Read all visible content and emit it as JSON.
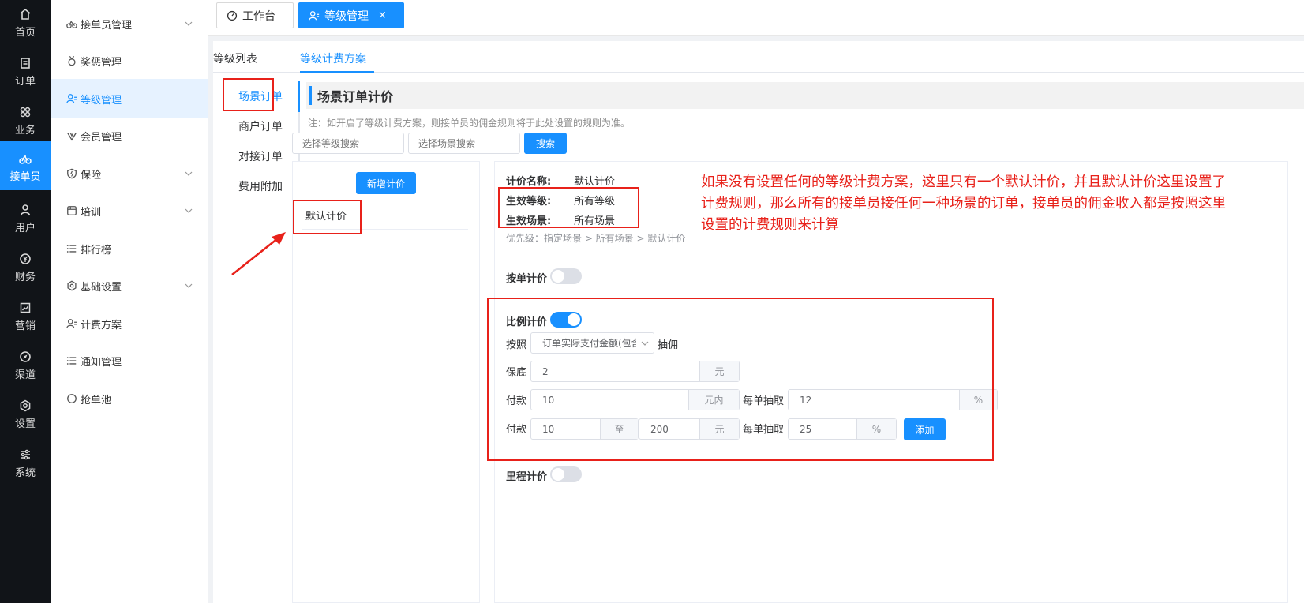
{
  "nav_rail": [
    {
      "icon": "home-icon",
      "label": "首页"
    },
    {
      "icon": "order-icon",
      "label": "订单"
    },
    {
      "icon": "grid-icon",
      "label": "业务"
    },
    {
      "icon": "bike-icon",
      "label": "接单员"
    },
    {
      "icon": "user-icon",
      "label": "用户"
    },
    {
      "icon": "yen-icon",
      "label": "财务"
    },
    {
      "icon": "chart-icon",
      "label": "营销"
    },
    {
      "icon": "compass-icon",
      "label": "渠道"
    },
    {
      "icon": "settings-icon",
      "label": "设置"
    },
    {
      "icon": "sliders-icon",
      "label": "系统"
    }
  ],
  "submenu": [
    {
      "icon": "bike-icon",
      "label": "接单员管理",
      "expandable": true
    },
    {
      "icon": "medal-icon",
      "label": "奖惩管理",
      "expandable": false
    },
    {
      "icon": "user-level-icon",
      "label": "等级管理",
      "expandable": false
    },
    {
      "icon": "vip-icon",
      "label": "会员管理",
      "expandable": false
    },
    {
      "icon": "shield-icon",
      "label": "保险",
      "expandable": true
    },
    {
      "icon": "training-icon",
      "label": "培训",
      "expandable": true
    },
    {
      "icon": "list-icon",
      "label": "排行榜",
      "expandable": false
    },
    {
      "icon": "hexagon-icon",
      "label": "基础设置",
      "expandable": true
    },
    {
      "icon": "user-level-icon",
      "label": "计费方案",
      "expandable": false
    },
    {
      "icon": "list-icon",
      "label": "通知管理",
      "expandable": false
    },
    {
      "icon": "circle-icon",
      "label": "抢单池",
      "expandable": false
    }
  ],
  "top_tabs": [
    {
      "icon": "dashboard-icon",
      "label": "工作台"
    },
    {
      "icon": "user-level-icon",
      "label": "等级管理",
      "close": "×"
    }
  ],
  "sub_tabs": [
    "等级列表",
    "等级计费方案"
  ],
  "vertical_tabs": [
    "场景订单",
    "商户订单",
    "对接订单",
    "费用附加"
  ],
  "section_title": "场景订单计价",
  "note": "注：如开启了等级计费方案，则接单员的佣金规则将于此处设置的规则为准。",
  "filters": {
    "level_placeholder": "选择等级搜索",
    "scene_placeholder": "选择场景搜索",
    "search_label": "搜索"
  },
  "list": {
    "add_label": "新增计价",
    "items": [
      "默认计价"
    ]
  },
  "detail": {
    "name_label": "计价名称:",
    "name_value": "默认计价",
    "level_label": "生效等级:",
    "level_value": "所有等级",
    "scene_label": "生效场景:",
    "scene_value": "所有场景",
    "priority": "优先级：指定场景 > 所有场景 > 默认计价",
    "per_order_label": "按单计价",
    "per_order_on": false,
    "ratio_label": "比例计价",
    "ratio_on": true,
    "basis_prefix": "按照",
    "basis_select": "订单实际支付金额(包含",
    "basis_suffix": "抽佣",
    "min_label": "保底",
    "min_value": "2",
    "min_unit": "元",
    "rule1": {
      "pay_label": "付款",
      "pay_value": "10",
      "pay_unit": "元内",
      "cut_label": "每单抽取",
      "cut_value": "12",
      "cut_unit": "%"
    },
    "rule2": {
      "pay_label": "付款",
      "from_value": "10",
      "to_word": "至",
      "to_value": "200",
      "to_unit": "元",
      "cut_label": "每单抽取",
      "cut_value": "25",
      "cut_unit": "%",
      "add_label": "添加"
    },
    "mileage_label": "里程计价",
    "mileage_on": false
  },
  "annotation": "如果没有设置任何的等级计费方案，这里只有一个默认计价，并且默认计价这里设置了计费规则，那么所有的接单员接任何一种场景的订单，接单员的佣金收入都是按照这里设置的计费规则来计算",
  "colors": {
    "primary": "#1890ff",
    "rail_bg": "#111418",
    "annotation_red": "#e8211a"
  }
}
